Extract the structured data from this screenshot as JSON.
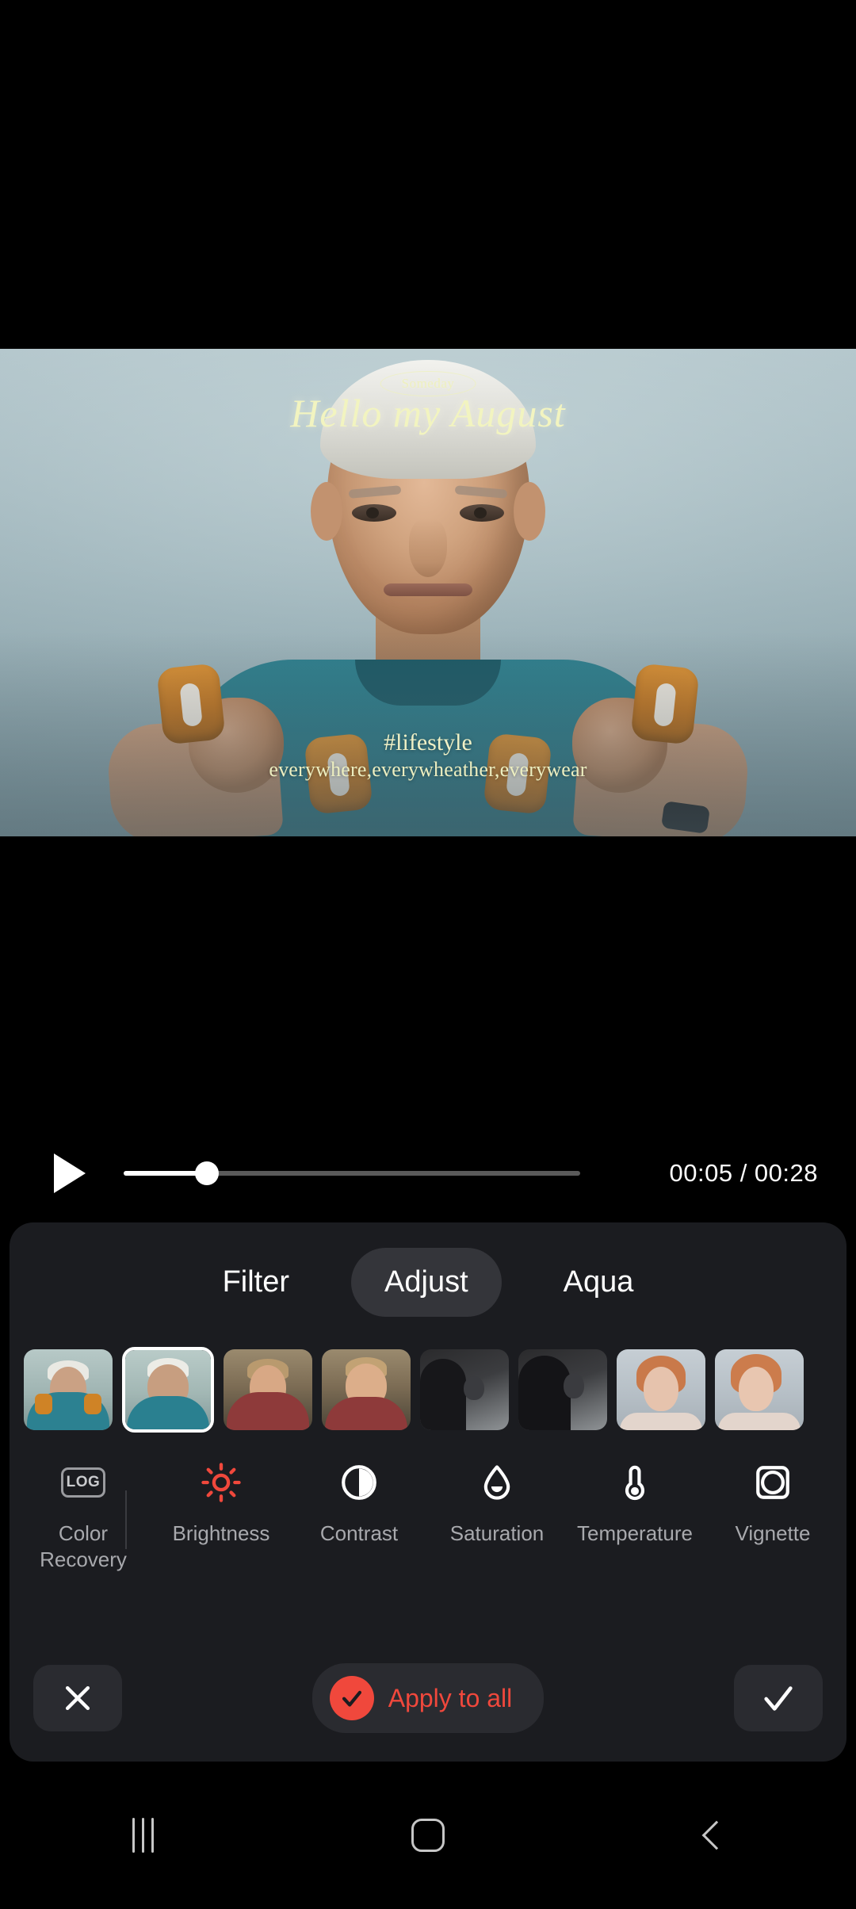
{
  "preview": {
    "overlay_badge": "Someday",
    "overlay_title": "Hello my August",
    "overlay_hashtag": "#lifestyle",
    "overlay_subtitle": "everywhere,everywheather,everywear"
  },
  "playback": {
    "play_icon": "play-icon",
    "current_time": "00:05",
    "total_time": "00:28",
    "timecode": "00:05 / 00:28",
    "progress_percent": 18
  },
  "tabs": [
    {
      "label": "Filter",
      "active": false
    },
    {
      "label": "Adjust",
      "active": true
    },
    {
      "label": "Aqua",
      "active": false
    }
  ],
  "thumbnails": [
    {
      "name": "clip-1",
      "selected": false,
      "scene": "man-dumbbells-wide"
    },
    {
      "name": "clip-2",
      "selected": true,
      "scene": "man-portrait"
    },
    {
      "name": "clip-3",
      "selected": false,
      "scene": "bearded-man-autumn"
    },
    {
      "name": "clip-4",
      "selected": false,
      "scene": "bearded-man-smile"
    },
    {
      "name": "clip-5",
      "selected": false,
      "scene": "boxing-bag"
    },
    {
      "name": "clip-6",
      "selected": false,
      "scene": "boxing-punch"
    },
    {
      "name": "clip-7",
      "selected": false,
      "scene": "woman-portrait"
    },
    {
      "name": "clip-8",
      "selected": false,
      "scene": "woman-portrait-hand"
    }
  ],
  "tools": [
    {
      "label": "Color\nRecovery",
      "icon": "log-icon",
      "active": false
    },
    {
      "label": "Brightness",
      "icon": "sun-icon",
      "active": true
    },
    {
      "label": "Contrast",
      "icon": "contrast-icon",
      "active": false
    },
    {
      "label": "Saturation",
      "icon": "droplet-icon",
      "active": false
    },
    {
      "label": "Temperature",
      "icon": "thermometer-icon",
      "active": false
    },
    {
      "label": "Vignette",
      "icon": "vignette-icon",
      "active": false
    }
  ],
  "log_icon_text": "LOG",
  "actions": {
    "cancel_label": "close-icon",
    "apply_to_all_label": "Apply to all",
    "confirm_label": "check-icon"
  },
  "navbar": {
    "recents": "recents-icon",
    "home": "home-icon",
    "back": "back-icon"
  },
  "colors": {
    "accent_red": "#f0483c",
    "panel_bg": "#1b1c20",
    "tab_active_bg": "#34353a",
    "label_gray": "#a8a9ad"
  }
}
